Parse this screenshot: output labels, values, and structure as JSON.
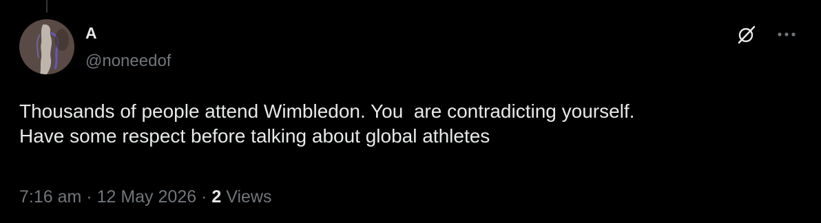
{
  "post": {
    "author": {
      "display_name": "A",
      "handle": "@noneedof"
    },
    "text": "Thousands of people attend Wimbledon. You  are contradicting yourself.\nHave some respect before talking about global athletes",
    "time": "7:16 am",
    "date": "12 May 2026",
    "separator": "·",
    "views_count": "2",
    "views_label": "Views"
  },
  "icons": {
    "grok": "grok-icon",
    "more": "more-horizontal-icon"
  },
  "colors": {
    "background": "#000000",
    "primary_text": "#e7e9ea",
    "secondary_text": "#71767b"
  }
}
